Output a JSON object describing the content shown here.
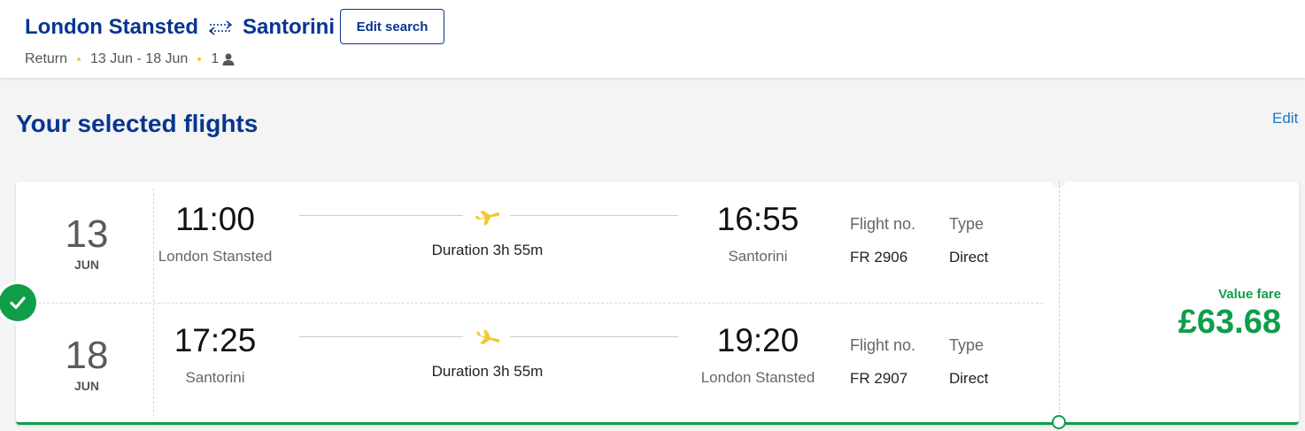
{
  "header": {
    "origin": "London Stansted",
    "destination": "Santorini",
    "edit_search_label": "Edit search",
    "trip_type": "Return",
    "dates": "13 Jun - 18 Jun",
    "passengers": "1"
  },
  "page": {
    "heading": "Your selected flights",
    "edit_label": "Edit"
  },
  "legs": [
    {
      "day": "13",
      "month": "JUN",
      "depart_time": "11:00",
      "depart_place": "London Stansted",
      "duration": "Duration 3h 55m",
      "arrive_time": "16:55",
      "arrive_place": "Santorini",
      "flight_no_label": "Flight no.",
      "flight_no": "FR 2906",
      "type_label": "Type",
      "type": "Direct"
    },
    {
      "day": "18",
      "month": "JUN",
      "depart_time": "17:25",
      "depart_place": "Santorini",
      "duration": "Duration 3h 55m",
      "arrive_time": "19:20",
      "arrive_place": "London Stansted",
      "flight_no_label": "Flight no.",
      "flight_no": "FR 2907",
      "type_label": "Type",
      "type": "Direct"
    }
  ],
  "fare": {
    "label": "Value fare",
    "price": "£63.68"
  },
  "colors": {
    "brand_blue": "#073590",
    "fare_green": "#0f9d4a",
    "plane_yellow": "#f1c932",
    "link_blue": "#1a73c8"
  },
  "icons": {
    "route": "swap-arrows-icon",
    "passenger": "person-icon",
    "plane": "plane-icon",
    "selected": "check-icon"
  }
}
